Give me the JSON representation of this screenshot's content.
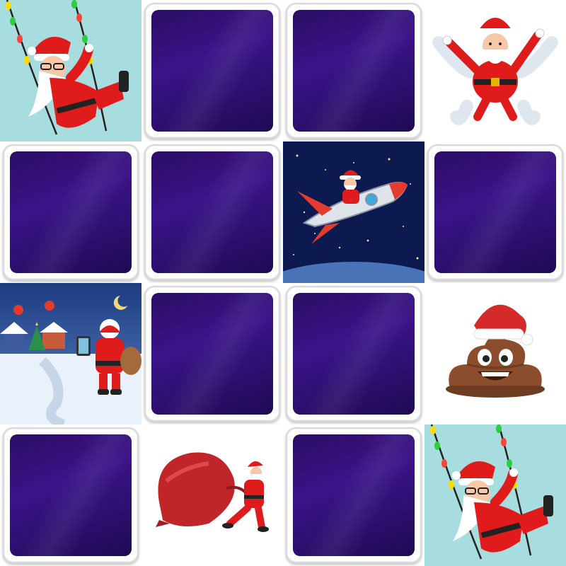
{
  "game": {
    "type": "memory-matching",
    "rows": 4,
    "cols": 4,
    "card_back_color": "#35137f",
    "cards": [
      {
        "row": 1,
        "col": 1,
        "state": "face-up",
        "image": "santa-on-swing"
      },
      {
        "row": 1,
        "col": 2,
        "state": "face-down"
      },
      {
        "row": 1,
        "col": 3,
        "state": "face-down"
      },
      {
        "row": 1,
        "col": 4,
        "state": "face-up",
        "image": "santa-snow-angel"
      },
      {
        "row": 2,
        "col": 1,
        "state": "face-down"
      },
      {
        "row": 2,
        "col": 2,
        "state": "face-down"
      },
      {
        "row": 2,
        "col": 3,
        "state": "face-up",
        "image": "santa-on-rocket"
      },
      {
        "row": 2,
        "col": 4,
        "state": "face-down"
      },
      {
        "row": 3,
        "col": 1,
        "state": "face-up",
        "image": "santa-with-map-in-village"
      },
      {
        "row": 3,
        "col": 2,
        "state": "face-down"
      },
      {
        "row": 3,
        "col": 3,
        "state": "face-down"
      },
      {
        "row": 3,
        "col": 4,
        "state": "face-up",
        "image": "poop-emoji-with-santa-hat"
      },
      {
        "row": 4,
        "col": 1,
        "state": "face-down"
      },
      {
        "row": 4,
        "col": 2,
        "state": "face-up",
        "image": "santa-pulling-sack"
      },
      {
        "row": 4,
        "col": 3,
        "state": "face-down"
      },
      {
        "row": 4,
        "col": 4,
        "state": "face-up",
        "image": "santa-on-swing"
      }
    ]
  }
}
